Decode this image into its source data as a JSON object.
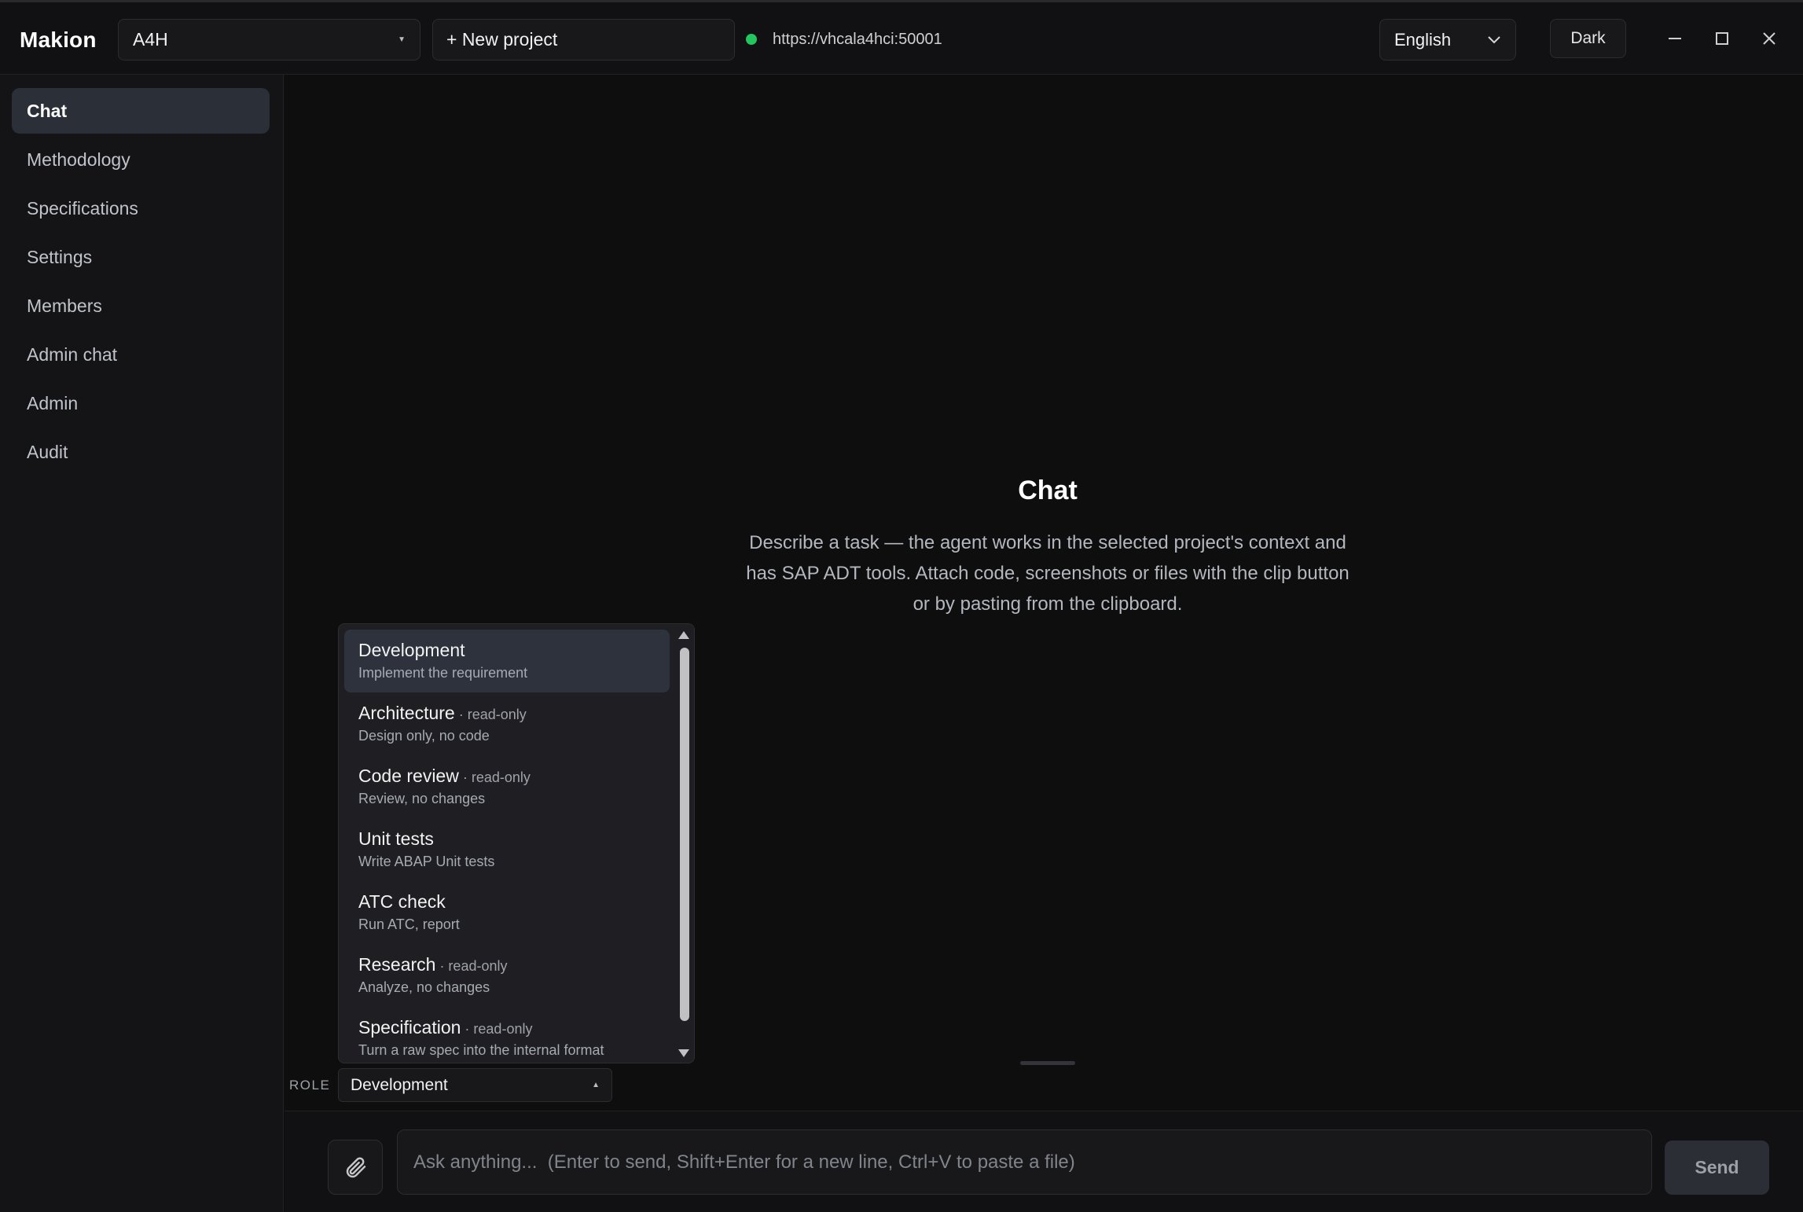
{
  "app": {
    "name": "Makion"
  },
  "header": {
    "project": "A4H",
    "new_project_label": "+ New project",
    "server_url": "https://vhcala4hci:50001",
    "language": "English",
    "theme_label": "Dark",
    "status_color": "#22c55e"
  },
  "sidebar": {
    "items": [
      {
        "label": "Chat",
        "active": true
      },
      {
        "label": "Methodology"
      },
      {
        "label": "Specifications"
      },
      {
        "label": "Settings"
      },
      {
        "label": "Members"
      },
      {
        "label": "Admin chat"
      },
      {
        "label": "Admin"
      },
      {
        "label": "Audit"
      }
    ]
  },
  "main": {
    "title": "Chat",
    "description": "Describe a task — the agent works in the selected project's context and has SAP ADT tools. Attach code, screenshots or files with the clip button or by pasting from the clipboard."
  },
  "role": {
    "label": "ROLE",
    "selected": "Development",
    "options": [
      {
        "name": "Development",
        "tag": "",
        "desc": "Implement the requirement"
      },
      {
        "name": "Architecture",
        "tag": " · read-only",
        "desc": "Design only, no code"
      },
      {
        "name": "Code review",
        "tag": " · read-only",
        "desc": "Review, no changes"
      },
      {
        "name": "Unit tests",
        "tag": "",
        "desc": "Write ABAP Unit tests"
      },
      {
        "name": "ATC check",
        "tag": "",
        "desc": "Run ATC, report"
      },
      {
        "name": "Research",
        "tag": " · read-only",
        "desc": "Analyze, no changes"
      },
      {
        "name": "Specification",
        "tag": " · read-only",
        "desc": "Turn a raw spec into the internal format"
      }
    ]
  },
  "composer": {
    "placeholder": "Ask anything...  (Enter to send, Shift+Enter for a new line, Ctrl+V to paste a file)",
    "send_label": "Send"
  },
  "icons": {
    "attach": "paperclip-icon",
    "minimize": "minimize-icon",
    "maximize": "maximize-icon",
    "close": "close-icon"
  }
}
